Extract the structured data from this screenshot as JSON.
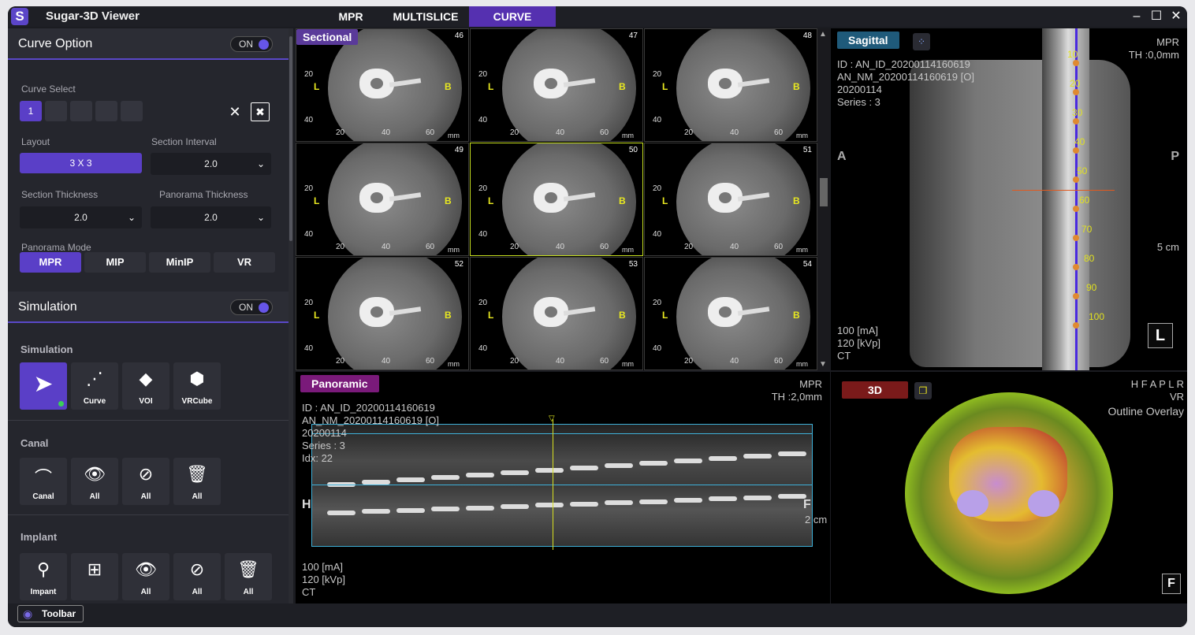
{
  "app": {
    "logo": "S",
    "title": "Sugar-3D Viewer"
  },
  "tabs": [
    {
      "label": "MPR"
    },
    {
      "label": "MULTISLICE"
    },
    {
      "label": "CURVE"
    }
  ],
  "window_controls": {
    "minimize": "–",
    "maximize": "☐",
    "close": "✕"
  },
  "curve_option": {
    "title": "Curve Option",
    "toggle": "ON",
    "curve_select_label": "Curve Select",
    "curve_boxes": [
      "1",
      "",
      "",
      "",
      ""
    ],
    "layout_label": "Layout",
    "layout_value": "3 X 3",
    "section_interval_label": "Section Interval",
    "section_interval_value": "2.0",
    "section_thickness_label": "Section Thickness",
    "section_thickness_value": "2.0",
    "panorama_thickness_label": "Panorama Thickness",
    "panorama_thickness_value": "2.0",
    "panorama_mode_label": "Panorama Mode",
    "modes": [
      "MPR",
      "MIP",
      "MinIP",
      "VR"
    ]
  },
  "simulation": {
    "title": "Simulation",
    "toggle": "ON",
    "sim_label": "Simulation",
    "sim_tools": [
      {
        "cap": ""
      },
      {
        "cap": "Curve"
      },
      {
        "cap": "VOI"
      },
      {
        "cap": "VRCube"
      }
    ],
    "canal_label": "Canal",
    "canal_tools": [
      {
        "cap": "Canal"
      },
      {
        "cap": "All"
      },
      {
        "cap": "All"
      },
      {
        "cap": "All"
      }
    ],
    "implant_label": "Implant",
    "implant_tools": [
      {
        "cap": "Impant"
      },
      {
        "cap": ""
      },
      {
        "cap": "All"
      },
      {
        "cap": "All"
      },
      {
        "cap": "All"
      }
    ]
  },
  "toolbar_button": "Toolbar",
  "sectional": {
    "label": "Sectional",
    "cells": [
      {
        "num": "46"
      },
      {
        "num": "47"
      },
      {
        "num": "48"
      },
      {
        "num": "49"
      },
      {
        "num": "50"
      },
      {
        "num": "51"
      },
      {
        "num": "52"
      },
      {
        "num": "53"
      },
      {
        "num": "54"
      }
    ],
    "left_marker": "L",
    "right_marker": "B",
    "y_ticks": [
      "20",
      "40"
    ],
    "x_ticks": [
      "20",
      "40",
      "60"
    ],
    "unit": "mm"
  },
  "sagittal": {
    "label": "Sagittal",
    "top_right": [
      "MPR",
      "TH :0,0mm"
    ],
    "info": [
      "ID : AN_ID_20200114160619",
      "AN_NM_20200114160619 [O]",
      "20200114",
      "Series : 3"
    ],
    "left_dir": "A",
    "right_dir": "P",
    "scale": "5 cm",
    "bottom_info": [
      "100  [mA]",
      "120  [kVp]",
      "CT"
    ],
    "corner": "L",
    "ticks": [
      "10",
      "20",
      "30",
      "40",
      "50",
      "60",
      "70",
      "80",
      "90",
      "100"
    ]
  },
  "panoramic": {
    "label": "Panoramic",
    "top_right": [
      "MPR",
      "TH :2,0mm"
    ],
    "info": [
      "ID : AN_ID_20200114160619",
      "AN_NM_20200114160619 [O]",
      "20200114",
      "Series : 3",
      "Idx: 22"
    ],
    "left_dir": "H",
    "right_dir": "F",
    "scale": "2 cm",
    "bottom_info": [
      "100  [mA]",
      "120  [kVp]",
      "CT"
    ]
  },
  "view3d": {
    "label": "3D",
    "top_right": [
      "H F A P L R",
      "VR",
      "Outline Overlay"
    ],
    "corner": "F"
  },
  "colors": {
    "accent": "#5a3fc7",
    "sectional_label": "#5a3a9a",
    "sagittal_label": "#1f5a7a",
    "panoramic_label": "#7a1a7a",
    "view3d_label": "#8a1a1a",
    "marker_yellow": "#e8e820",
    "curve": "#4a2adf"
  }
}
